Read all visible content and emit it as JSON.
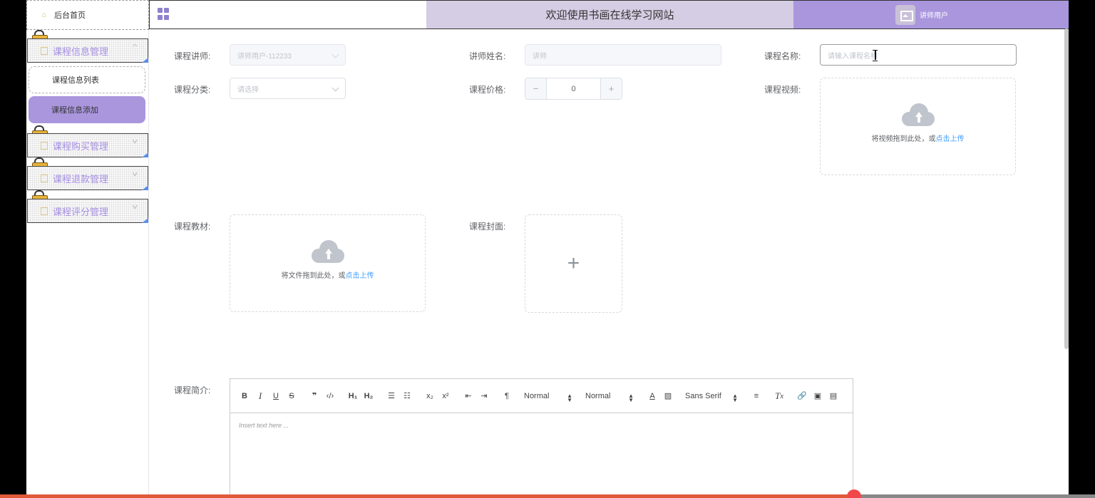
{
  "header": {
    "home_label": "后台首页",
    "welcome_text": "欢迎使用书画在线学习网站",
    "user_name": "讲师用户"
  },
  "sidebar": {
    "groups": [
      {
        "label": "课程信息管理"
      },
      {
        "label": "课程购买管理"
      },
      {
        "label": "课程退款管理"
      },
      {
        "label": "课程评分管理"
      }
    ],
    "sub_items": [
      {
        "label": "课程信息列表"
      },
      {
        "label": "课程信息添加"
      }
    ]
  },
  "form": {
    "teacher_label": "课程讲师:",
    "teacher_value": "讲师用户-112233",
    "teacher_name_label": "讲师姓名:",
    "teacher_name_value": "讲师",
    "course_name_label": "课程名称:",
    "course_name_placeholder": "请输入课程名称",
    "category_label": "课程分类:",
    "category_placeholder": "请选择",
    "price_label": "课程价格:",
    "price_value": "0",
    "price_minus": "−",
    "price_plus": "+",
    "video_label": "课程视频:",
    "video_upload_text": "将视频拖到此处，或",
    "video_upload_link": "点击上传",
    "material_label": "课程教材:",
    "material_upload_text": "将文件拖到此处，或",
    "material_upload_link": "点击上传",
    "cover_label": "课程封面:",
    "cover_plus": "+",
    "intro_label": "课程简介:"
  },
  "editor": {
    "header_select": "Normal",
    "size_select": "Normal",
    "font_select": "Sans Serif",
    "placeholder": "Insert text here ..."
  },
  "video_progress": 0.78,
  "colors": {
    "accent": "#a996dd",
    "header_band": "#d5cde3",
    "menu_text": "#a58ee3",
    "link": "#409eff",
    "progress": "#e05a3a"
  }
}
